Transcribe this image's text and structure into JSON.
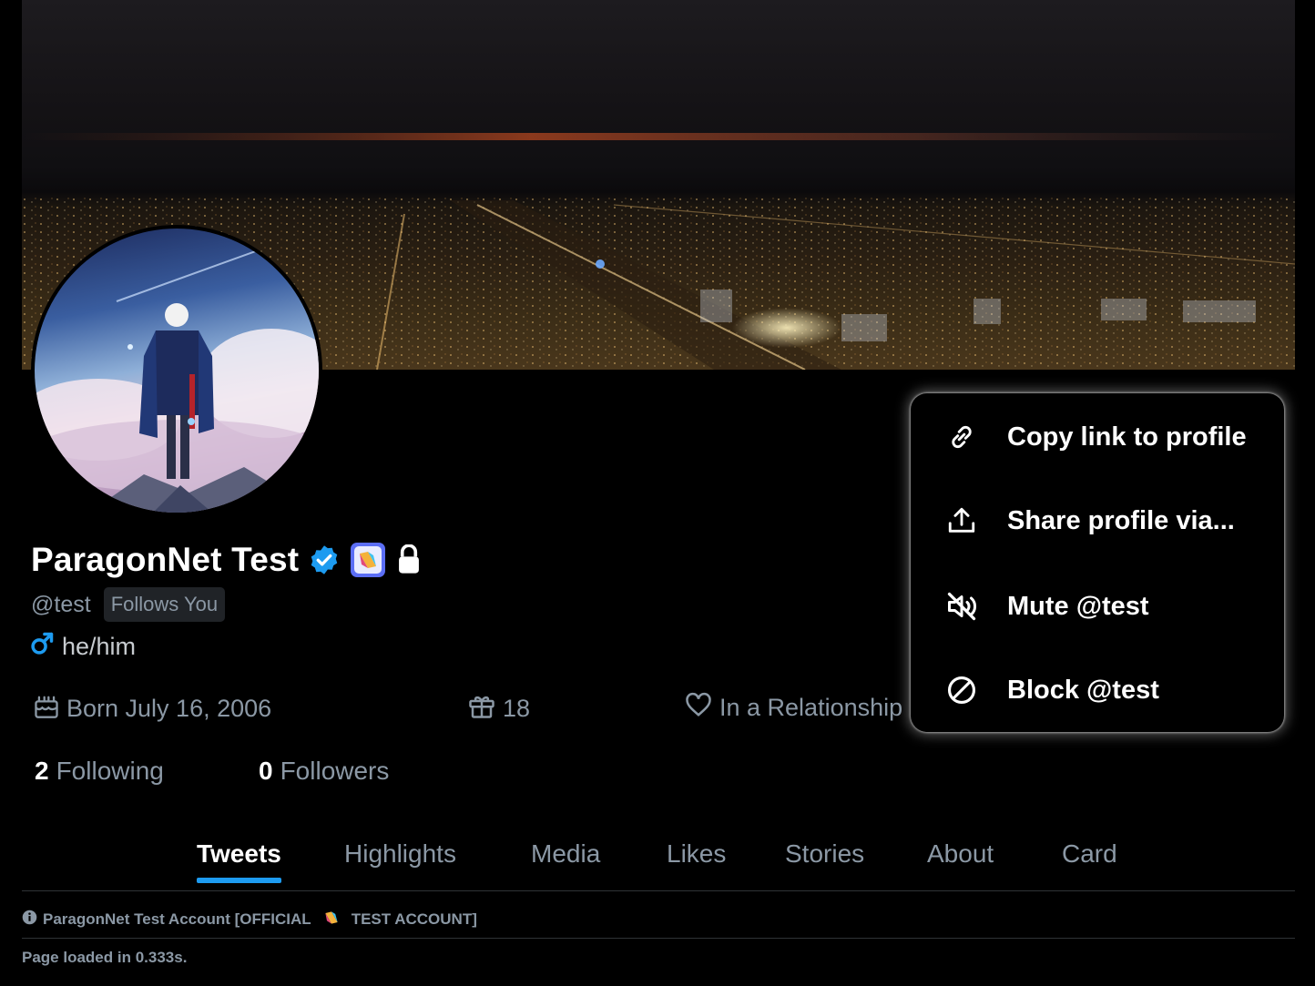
{
  "profile": {
    "display_name": "ParagonNet Test",
    "handle": "@test",
    "follows_you": "Follows You",
    "pronouns": "he/him",
    "born": "Born July 16, 2006",
    "age": "18",
    "relationship": "In a Relationship",
    "following_count": "2",
    "following_label": "Following",
    "followers_count": "0",
    "followers_label": "Followers"
  },
  "tabs": [
    {
      "label": "Tweets",
      "active": true
    },
    {
      "label": "Highlights"
    },
    {
      "label": "Media"
    },
    {
      "label": "Likes"
    },
    {
      "label": "Stories"
    },
    {
      "label": "About"
    },
    {
      "label": "Card"
    }
  ],
  "menu": {
    "items": [
      {
        "label": "Copy link to profile",
        "icon": "link-icon"
      },
      {
        "label": "Share profile via...",
        "icon": "share-upload-icon"
      },
      {
        "label": "Mute @test",
        "icon": "mute-icon"
      },
      {
        "label": "Block @test",
        "icon": "block-icon"
      }
    ]
  },
  "footer": {
    "account_note_prefix": "ParagonNet Test Account [OFFICIAL",
    "account_note_suffix": "TEST ACCOUNT]",
    "load_time": "Page loaded in 0.333s."
  },
  "colors": {
    "accent": "#1d9bf0",
    "verified": "#1d9bf0",
    "muted_text": "#8b98a5",
    "background": "#000000"
  }
}
